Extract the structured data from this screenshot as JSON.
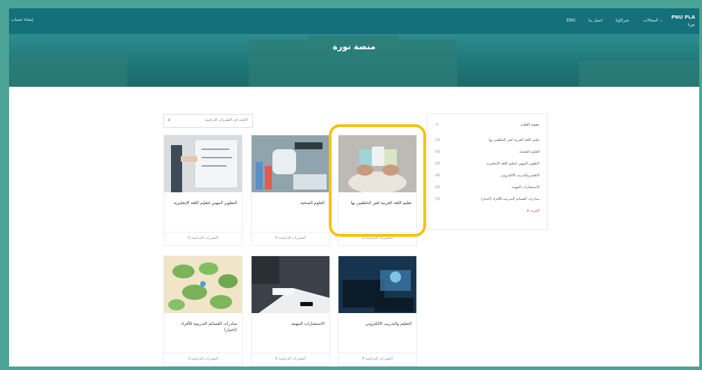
{
  "nav": {
    "brand_line1": "PNU PLA",
    "brand_line2": "نورة",
    "categories": "المجالات",
    "partners": "شركاؤنا",
    "contact": "اتصل بنا",
    "lang": "ENG",
    "signup": "إنشاء حساب"
  },
  "hero": {
    "title": "منصة نورة"
  },
  "search": {
    "placeholder": "البحث في المقررات الدراسية"
  },
  "sidebar": {
    "heading": "تصفية الفئات",
    "items": [
      {
        "label": "تعليم اللغة العربية لغير الناطقين بها",
        "count": "(3)"
      },
      {
        "label": "العلوم الصحية",
        "count": "(0)"
      },
      {
        "label": "التطوير المهني لتعليم اللغة الإنجليزية",
        "count": "(0)"
      },
      {
        "label": "التعليم والتدريب الالكتروني",
        "count": "(4)"
      },
      {
        "label": "الاستشارات المهنية",
        "count": "(0)"
      },
      {
        "label": "مبادرات القسائم التدريبية للأفراد (اختبار)",
        "count": "(3)"
      }
    ],
    "more": "المزيد"
  },
  "courses": [
    {
      "title": "تعليم اللغة العربية لغير الناطقين بها",
      "footer": "3 المقررات الدراسية"
    },
    {
      "title": "العلوم الصحية",
      "footer": "0 المقررات الدراسية"
    },
    {
      "title": "التطوير المهني لتعليم اللغة الإنجليزية",
      "footer": "0 المقررات الدراسية"
    },
    {
      "title": "التعليم والتدريب الالكتروني",
      "footer": "4 المقررات الدراسية"
    },
    {
      "title": "الاستشارات المهنية",
      "footer": "0 المقررات الدراسية"
    },
    {
      "title": "مبادرات القسائم التدريبية للأفراد (اختبار)",
      "footer": "3 المقررات الدراسية"
    }
  ],
  "colors": {
    "topbar": "#14707a",
    "frame": "#4aa394",
    "highlight": "#f4c20d",
    "more": "#c94040"
  },
  "icons": {
    "search": "search-icon",
    "more": "plus-icon",
    "course_footer": "book-icon",
    "dropdown": "chevron-down-icon"
  }
}
